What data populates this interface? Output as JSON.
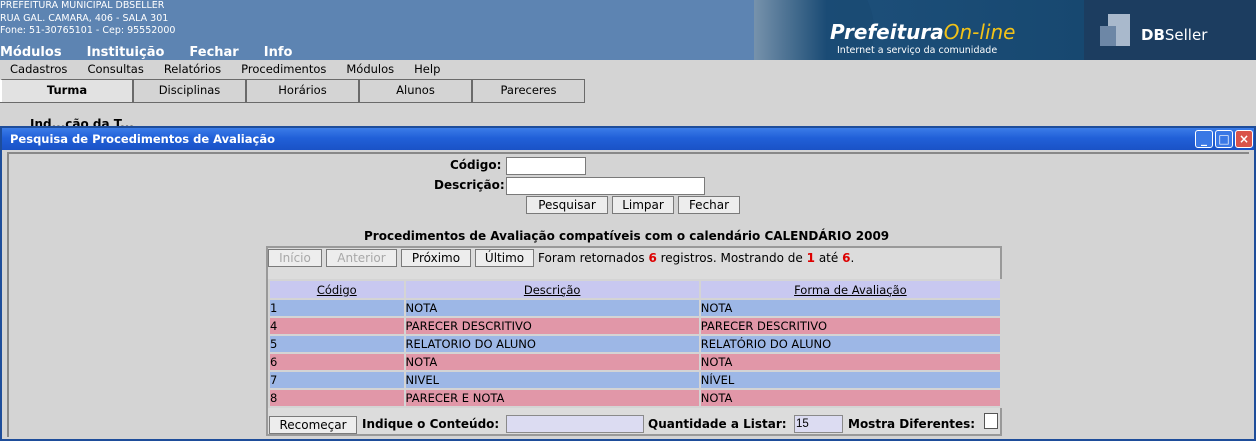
{
  "header": {
    "org_lines": [
      "PREFEITURA MUNICIPAL DBSELLER",
      "RUA GAL. CAMARA, 406 - SALA 301",
      "Fone: 51-30765101  -  Cep: 95552000"
    ],
    "top_menu": [
      "Módulos",
      "Instituição",
      "Fechar",
      "Info"
    ],
    "brand_main": "Prefeitura",
    "brand_online": "On-line",
    "brand_sub": "Internet a serviço da comunidade",
    "dbseller_bold": "DB",
    "dbseller_rest": "Seller"
  },
  "menubar": [
    "Cadastros",
    "Consultas",
    "Relatórios",
    "Procedimentos",
    "Módulos",
    "Help"
  ],
  "tabs": [
    "Turma",
    "Disciplinas",
    "Horários",
    "Alunos",
    "Pareceres"
  ],
  "behind_text": "Ind...ção da T...",
  "window": {
    "title": "Pesquisa de Procedimentos de Avaliação",
    "codigo_label": "Código:",
    "descricao_label": "Descrição:",
    "codigo_value": "",
    "descricao_value": "",
    "buttons": {
      "pesquisar": "Pesquisar",
      "limpar": "Limpar",
      "fechar": "Fechar"
    },
    "result_title": "Procedimentos de Avaliação compatíveis com o calendário CALENDÁRIO 2009",
    "nav": {
      "inicio": "Início",
      "anterior": "Anterior",
      "proximo": "Próximo",
      "ultimo": "Último"
    },
    "info_prefix": "Foram retornados",
    "info_total": "6",
    "info_mid": "registros. Mostrando de",
    "info_from": "1",
    "info_ate": "até",
    "info_to": "6",
    "info_end": ".",
    "columns": [
      "Código",
      "Descrição",
      "Forma de Avaliação"
    ],
    "rows": [
      {
        "codigo": "1",
        "descricao": "NOTA",
        "forma": "NOTA",
        "color": "blue"
      },
      {
        "codigo": "4",
        "descricao": "PARECER DESCRITIVO",
        "forma": "PARECER DESCRITIVO",
        "color": "pink"
      },
      {
        "codigo": "5",
        "descricao": "RELATORIO DO ALUNO",
        "forma": "RELATÓRIO DO ALUNO",
        "color": "blue"
      },
      {
        "codigo": "6",
        "descricao": "NOTA",
        "forma": "NOTA",
        "color": "pink"
      },
      {
        "codigo": "7",
        "descricao": "NIVEL",
        "forma": "NÍVEL",
        "color": "blue"
      },
      {
        "codigo": "8",
        "descricao": "PARECER E NOTA",
        "forma": "NOTA",
        "color": "pink"
      }
    ],
    "footer": {
      "recomecar": "Recomeçar",
      "conteudo_label": "Indique o Conteúdo:",
      "conteudo_value": "",
      "quantidade_label": "Quantidade a Listar:",
      "quantidade_value": "15",
      "diferentes_label": "Mostra Diferentes:"
    },
    "colors": {
      "title_blue": "#2160d8",
      "row_blue": "#9db7e6",
      "row_pink": "#e197a8",
      "header_lilac": "#c8c8f0"
    }
  }
}
